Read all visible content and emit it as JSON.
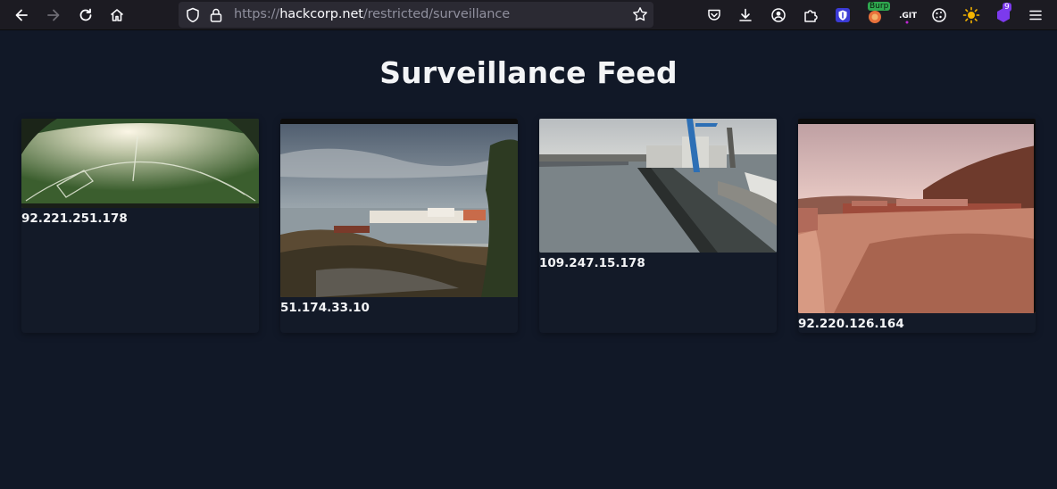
{
  "browser": {
    "url_scheme": "https://",
    "url_host": "hackcorp.net",
    "url_path": "/restricted/surveillance",
    "extension_badges": {
      "burp": "Burp",
      "notifications_count": "9"
    }
  },
  "page": {
    "title": "Surveillance Feed"
  },
  "feeds": [
    {
      "ip": "92.221.251.178",
      "scene": "stadium"
    },
    {
      "ip": "51.174.33.10",
      "scene": "harbor"
    },
    {
      "ip": "109.247.15.178",
      "scene": "pier"
    },
    {
      "ip": "92.220.126.164",
      "scene": "valley"
    }
  ]
}
